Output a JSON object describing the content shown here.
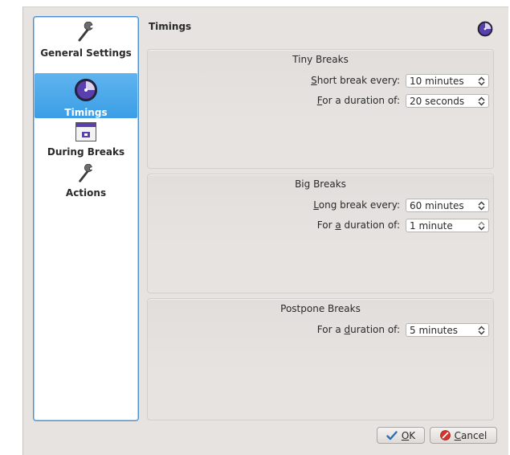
{
  "sidebar": {
    "items": [
      {
        "label": "General Settings",
        "icon": "wrench-icon",
        "selected": false
      },
      {
        "label": "Timings",
        "icon": "clock-icon",
        "selected": true
      },
      {
        "label": "During Breaks",
        "icon": "window-icon",
        "selected": false
      },
      {
        "label": "Actions",
        "icon": "wrench-icon",
        "selected": false
      }
    ]
  },
  "header": {
    "title": "Timings",
    "icon": "clock-icon"
  },
  "groups": {
    "tiny": {
      "title": "Tiny Breaks",
      "rows": [
        {
          "label_pre": "",
          "label_key": "S",
          "label_post": "hort break every:",
          "value": "10 minutes"
        },
        {
          "label_pre": "",
          "label_key": "F",
          "label_post": "or a duration of:",
          "value": "20 seconds"
        }
      ]
    },
    "big": {
      "title": "Big Breaks",
      "rows": [
        {
          "label_pre": "",
          "label_key": "L",
          "label_post": "ong break every:",
          "value": "60 minutes"
        },
        {
          "label_pre": "For ",
          "label_key": "a",
          "label_post": " duration of:",
          "value": "1 minute"
        }
      ]
    },
    "postpone": {
      "title": "Postpone Breaks",
      "rows": [
        {
          "label_pre": "For a ",
          "label_key": "d",
          "label_post": "uration of:",
          "value": "5 minutes"
        }
      ]
    }
  },
  "buttons": {
    "ok": {
      "key": "O",
      "rest": "K",
      "icon": "checkmark-icon"
    },
    "cancel": {
      "key": "C",
      "rest": "ancel",
      "icon": "cancel-icon"
    }
  },
  "colors": {
    "selection": "#3b9ee6",
    "accent_purple": "#5a3fae",
    "background": "#e6e3e0"
  }
}
